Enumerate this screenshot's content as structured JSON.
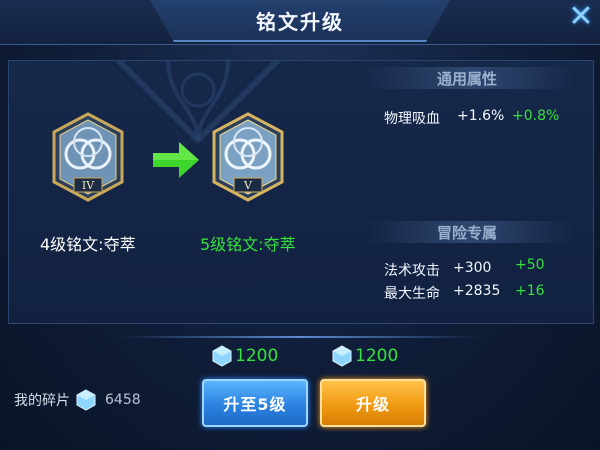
{
  "header": {
    "title": "铭文升级"
  },
  "close": {
    "icon": "close-icon"
  },
  "rune_from": {
    "level_numeral": "IV",
    "name": "4级铭文:夺萃"
  },
  "rune_to": {
    "level_numeral": "V",
    "name": "5级铭文:夺萃"
  },
  "general_attributes": {
    "title": "通用属性",
    "rows": [
      {
        "label": "物理吸血",
        "value": "+1.6%",
        "increase": "+0.8%"
      }
    ]
  },
  "adventure_attributes": {
    "title": "冒险专属",
    "rows": [
      {
        "label": "法术攻击",
        "value": "+300",
        "increase": "+50"
      },
      {
        "label": "最大生命",
        "value": "+2835",
        "increase": "+16"
      }
    ]
  },
  "costs": {
    "upgrade_to_5": "1200",
    "upgrade": "1200"
  },
  "inventory": {
    "label": "我的碎片",
    "value": "6458"
  },
  "buttons": {
    "upgrade_to_5": "升至5级",
    "upgrade": "升级"
  },
  "colors": {
    "accent_green": "#35e23b",
    "button_blue": "#2c82e0",
    "button_orange": "#f09a12"
  }
}
